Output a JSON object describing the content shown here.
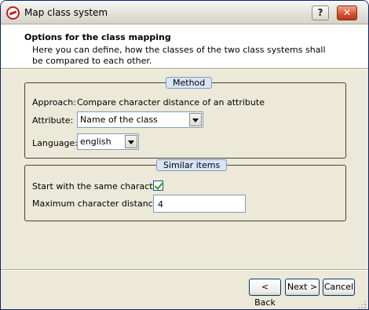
{
  "window": {
    "title": "Map class system",
    "help_label": "?",
    "close_label": "✕"
  },
  "header": {
    "title": "Options for the class mapping",
    "description": "Here you can define, how the classes of the two class systems shall be compared to each other."
  },
  "method": {
    "legend": "Method",
    "approach_label": "Approach:",
    "approach_value": "Compare character distance of an attribute",
    "attribute_label": "Attribute:",
    "attribute_value": "Name of the class",
    "language_label": "Language:",
    "language_value": "english"
  },
  "similar": {
    "legend": "Similar items",
    "same_char_label": "Start with the same character:",
    "same_char_checked": true,
    "max_distance_label": "Maximum character distance:",
    "max_distance_value": "4"
  },
  "buttons": {
    "back": "< Back",
    "next": "Next >",
    "cancel": "Cancel"
  }
}
